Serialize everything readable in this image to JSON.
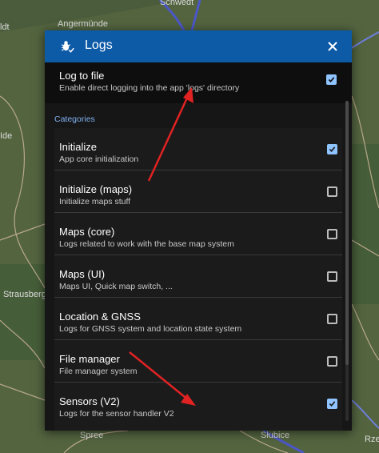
{
  "map": {
    "labels": [
      "Angermünde",
      "Strausberg",
      "Spree",
      "Słubice",
      "Rze",
      "Ide",
      "ldt",
      "Schwedt"
    ]
  },
  "dialog": {
    "title": "Logs",
    "icon": "bug-icon",
    "close_icon": "close-icon",
    "log_to_file": {
      "title": "Log to file",
      "description": "Enable direct logging into the app 'logs' directory",
      "checked": true
    },
    "categories_title": "Categories",
    "categories": [
      {
        "title": "Initialize",
        "description": "App core initialization",
        "checked": true
      },
      {
        "title": "Initialize (maps)",
        "description": "Initialize maps stuff",
        "checked": false
      },
      {
        "title": "Maps (core)",
        "description": "Logs related to work with the base map system",
        "checked": false
      },
      {
        "title": "Maps (UI)",
        "description": "Maps UI, Quick map switch, ...",
        "checked": false
      },
      {
        "title": "Location & GNSS",
        "description": "Logs for GNSS system and location state system",
        "checked": false
      },
      {
        "title": "File manager",
        "description": "File manager system",
        "checked": false
      },
      {
        "title": "Sensors (V2)",
        "description": "Logs for the sensor handler V2",
        "checked": true
      }
    ]
  },
  "colors": {
    "header": "#0d5aa7",
    "accent": "#7fb1f0",
    "arrow": "#e02222"
  }
}
